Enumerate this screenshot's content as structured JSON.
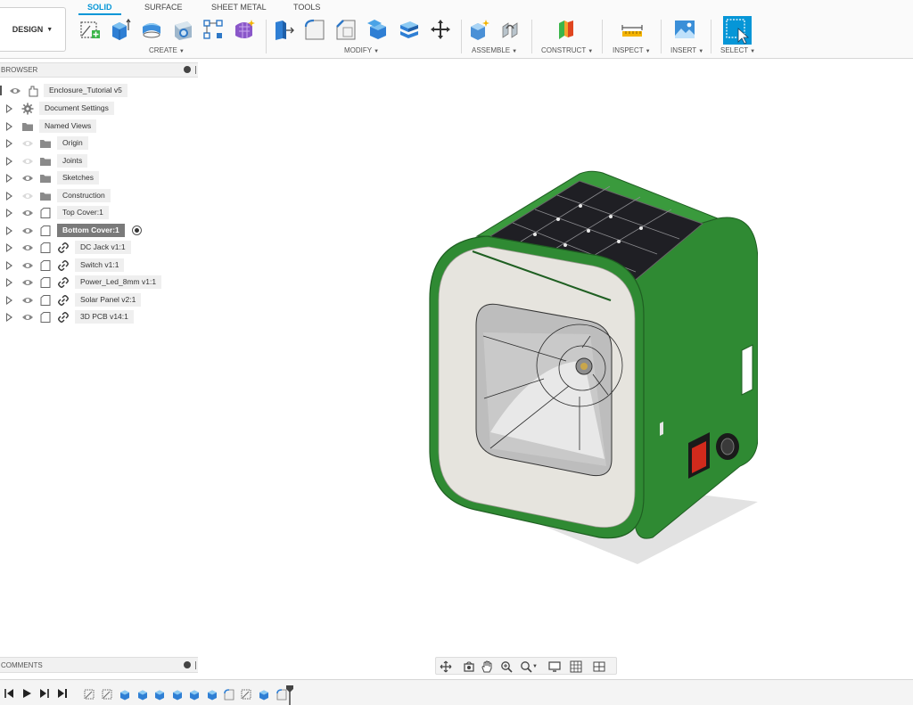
{
  "workspace": {
    "label": "DESIGN"
  },
  "tabs": [
    {
      "label": "SOLID",
      "active": true
    },
    {
      "label": "SURFACE",
      "active": false
    },
    {
      "label": "SHEET METAL",
      "active": false
    },
    {
      "label": "TOOLS",
      "active": false
    }
  ],
  "groups": {
    "create": "CREATE",
    "modify": "MODIFY",
    "assemble": "ASSEMBLE",
    "construct": "CONSTRUCT",
    "inspect": "INSPECT",
    "insert": "INSERT",
    "select": "SELECT"
  },
  "browser": {
    "title": "BROWSER",
    "root": "Enclosure_Tutorial v5",
    "items": [
      {
        "label": "Document Settings",
        "icon": "gear-icon"
      },
      {
        "label": "Named Views",
        "icon": "folder-icon"
      },
      {
        "label": "Origin",
        "icon": "folder-icon"
      },
      {
        "label": "Joints",
        "icon": "folder-icon"
      },
      {
        "label": "Sketches",
        "icon": "folder-icon"
      },
      {
        "label": "Construction",
        "icon": "folder-icon"
      },
      {
        "label": "Top Cover:1",
        "icon": "component-icon"
      },
      {
        "label": "Bottom Cover:1",
        "icon": "component-icon",
        "selected": true
      },
      {
        "label": "DC Jack v1:1",
        "icon": "link-icon"
      },
      {
        "label": "Switch v1:1",
        "icon": "link-icon"
      },
      {
        "label": "Power_Led_8mm v1:1",
        "icon": "link-icon"
      },
      {
        "label": "Solar Panel v2:1",
        "icon": "link-icon"
      },
      {
        "label": "3D PCB v14:1",
        "icon": "link-icon"
      }
    ]
  },
  "comments": {
    "title": "COMMENTS"
  },
  "colors": {
    "accent": "#0696d7",
    "enclosure_green": "#2f8a33",
    "bezel": "#e6e4de",
    "solar_panel": "#1f1f24",
    "switch_red": "#d12a1c"
  }
}
